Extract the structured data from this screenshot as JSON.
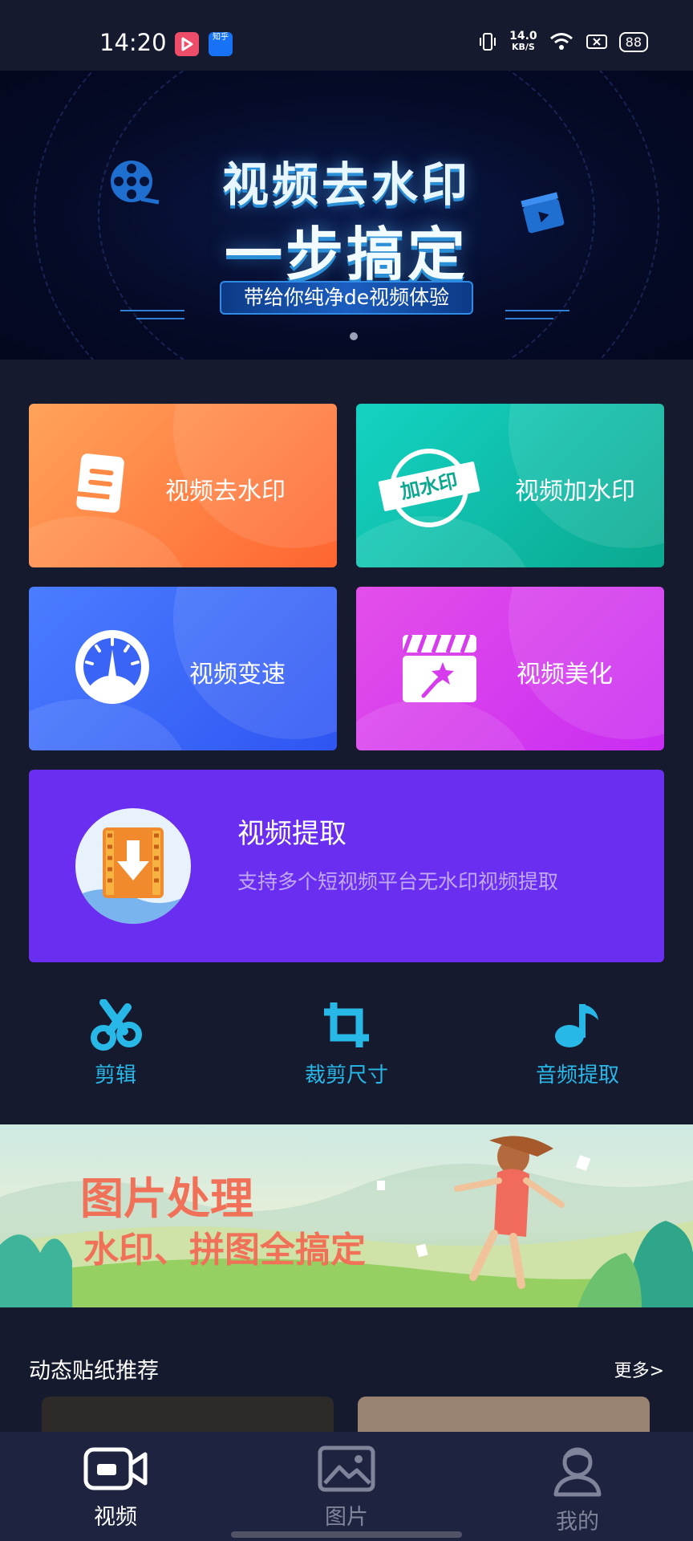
{
  "status_bar": {
    "time": "14:20",
    "zhihu_label": "知乎",
    "net_speed_value": "14.0",
    "net_speed_unit": "KB/S",
    "battery": "88"
  },
  "banner": {
    "title_line1": "视频去水印",
    "title_line2": "一步搞定",
    "subtitle": "带给你纯净de视频体验"
  },
  "features": {
    "remove_watermark": "视频去水印",
    "add_watermark": "视频加水印",
    "add_watermark_stamp": "加水印",
    "speed": "视频变速",
    "beautify": "视频美化"
  },
  "extract": {
    "title": "视频提取",
    "description": "支持多个短视频平台无水印视频提取"
  },
  "tools": [
    {
      "label": "剪辑",
      "icon": "scissors-icon"
    },
    {
      "label": "裁剪尺寸",
      "icon": "crop-icon"
    },
    {
      "label": "音频提取",
      "icon": "music-note-icon"
    }
  ],
  "picture_banner": {
    "title_line1": "图片处理",
    "title_line2": "水印、拼图全搞定"
  },
  "stickers": {
    "section_title": "动态贴纸推荐",
    "more": "更多>"
  },
  "tabbar": [
    {
      "label": "视频",
      "icon": "video-camera-icon",
      "active": true
    },
    {
      "label": "图片",
      "icon": "image-icon",
      "active": false
    },
    {
      "label": "我的",
      "icon": "user-icon",
      "active": false
    }
  ],
  "colors": {
    "background": "#161a2e",
    "tool_accent": "#28b8e8",
    "extract_card": "#6a2ef0"
  }
}
